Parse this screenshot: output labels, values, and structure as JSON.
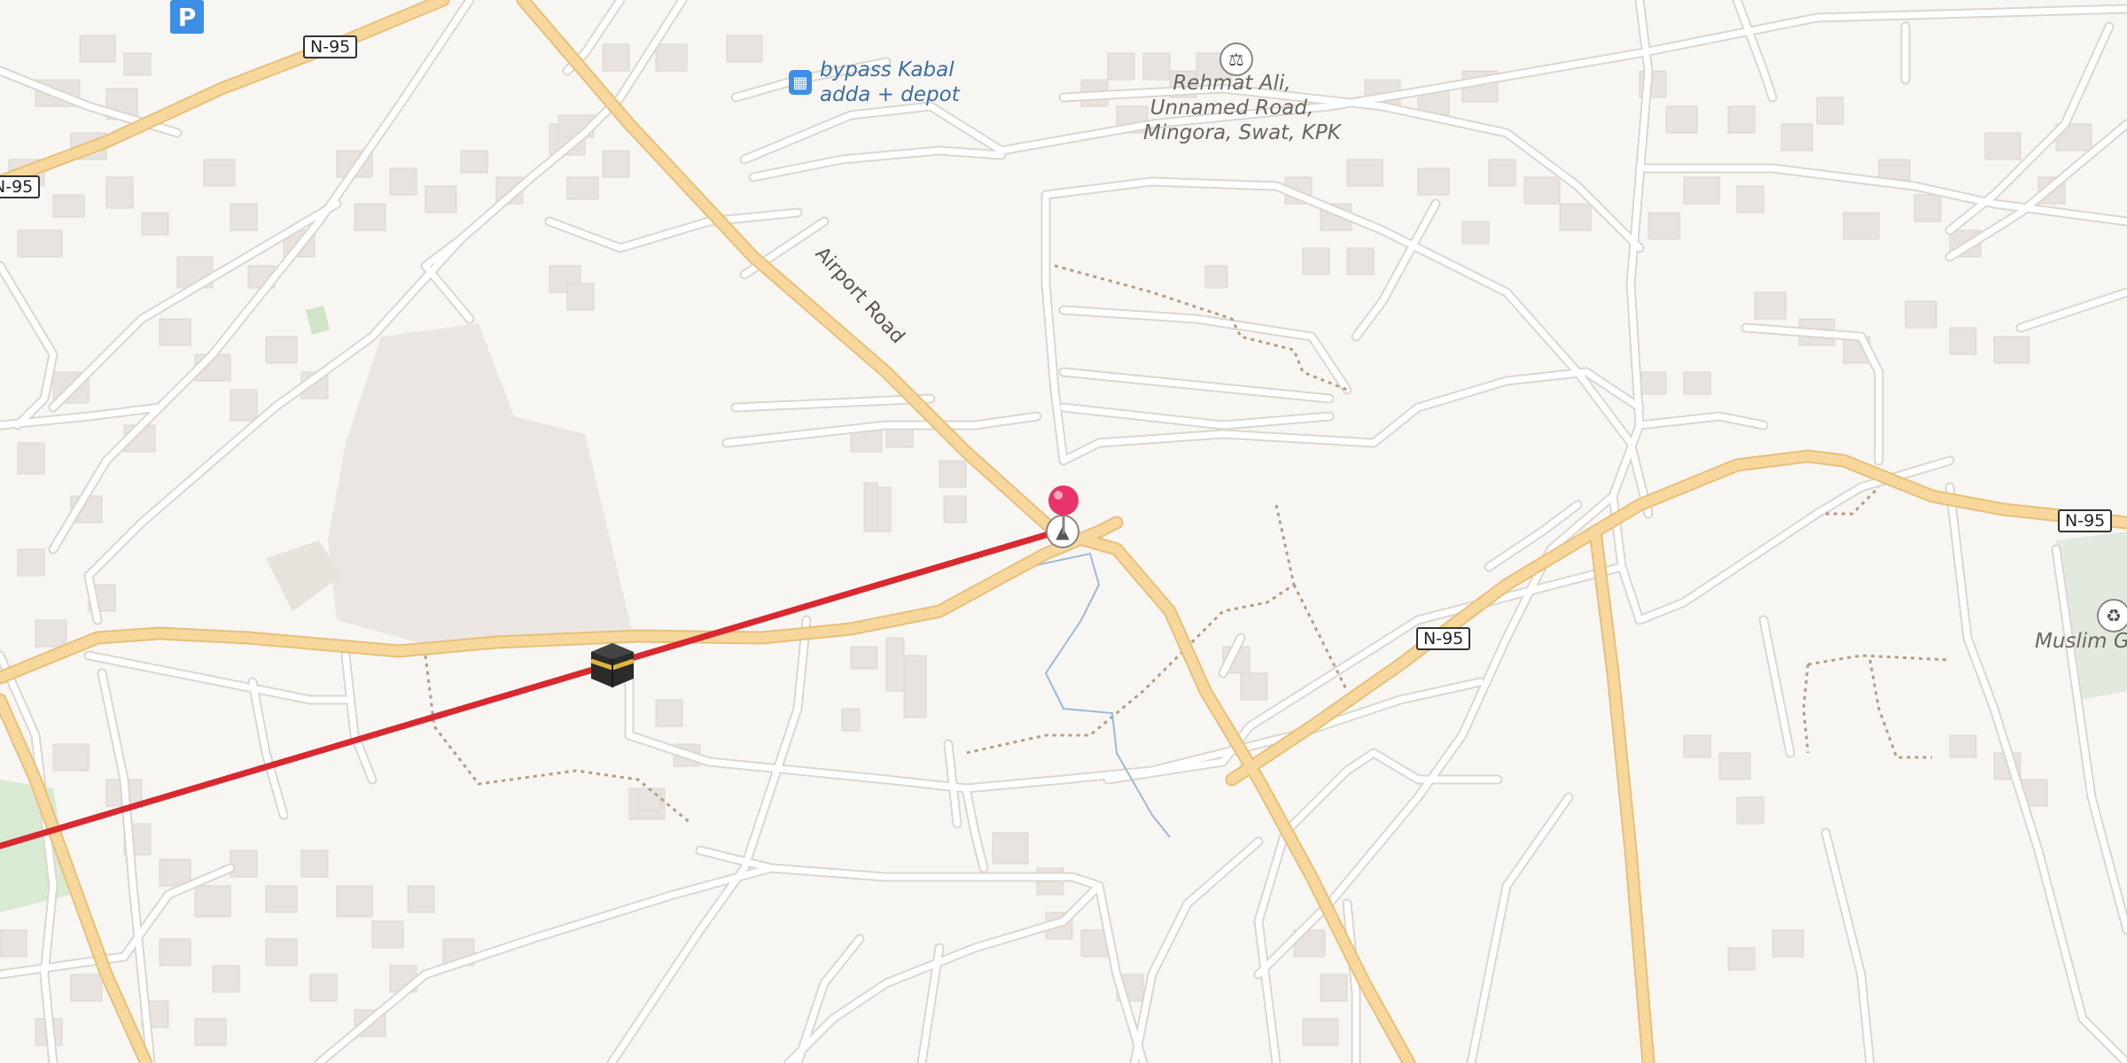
{
  "map": {
    "road_shields": [
      "N-95",
      "N-95",
      "N-95",
      "N-95"
    ],
    "street_label": "Airport Road",
    "places": {
      "bus_stop": {
        "name": "bypass Kabal adda + depot",
        "line1": "bypass Kabal",
        "line2": "adda + depot",
        "icon": "bus-icon"
      },
      "lodging": {
        "line1": "Rehmat Ali,",
        "line2": "Unnamed Road,",
        "line3": "Mingora, Swat, KPK",
        "icon": "bed-icon"
      },
      "cemetery": {
        "name": "Muslim Gr",
        "icon": "cemetery-icon"
      }
    },
    "parking": {
      "label": "P",
      "icon": "parking-icon"
    },
    "markers": {
      "location_pin": {
        "icon": "map-pin-icon",
        "color": "#e8336b"
      },
      "mosque": {
        "icon": "mosque-icon"
      },
      "destination": {
        "icon": "kaaba-icon"
      }
    },
    "qibla_line_color": "#d9282f",
    "colors": {
      "background": "#f8f6f3",
      "primary_road": "#f7d79c",
      "road_casing": "#e7c07a",
      "minor_road": "#ffffff",
      "building": "#e8e3de",
      "park": "#d9ead3"
    }
  }
}
